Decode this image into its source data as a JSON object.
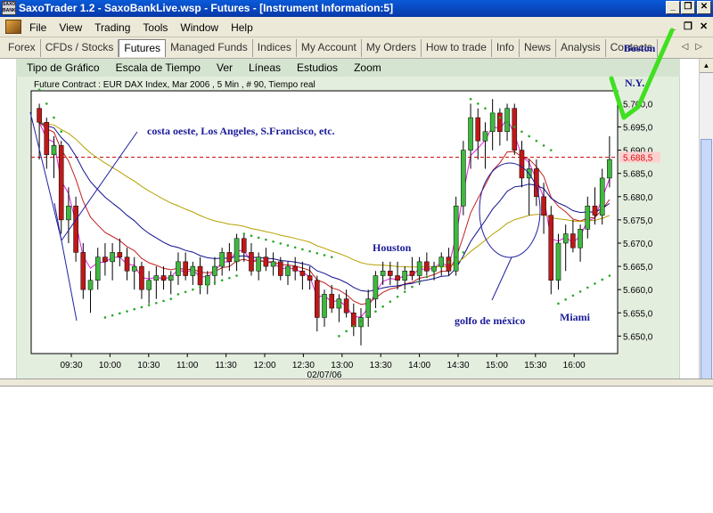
{
  "window": {
    "title": "SaxoTrader 1.2 - SaxoBankLive.wsp - Futures - [Instrument Information:5]",
    "app_icon_text": "SAXO BANK",
    "controls": {
      "minimize": "_",
      "restore": "❐",
      "close": "✕"
    }
  },
  "menubar": {
    "items": [
      "File",
      "View",
      "Trading",
      "Tools",
      "Window",
      "Help"
    ],
    "mdi_controls": {
      "minimize": "_",
      "restore": "❐",
      "close": "✕"
    }
  },
  "tabs": {
    "items": [
      "Forex",
      "CFDs / Stocks",
      "Futures",
      "Managed Funds",
      "Indices",
      "My Account",
      "My Orders",
      "How to trade",
      "Info",
      "News",
      "Analysis",
      "Contacts"
    ],
    "active": "Futures",
    "arrows": {
      "left": "◁",
      "right": "▷"
    }
  },
  "chart_menu": {
    "items": [
      "Tipo de Gráfico",
      "Escala de Tiempo",
      "Ver",
      "Líneas",
      "Estudios",
      "Zoom"
    ]
  },
  "chart_data": {
    "type": "candlestick",
    "title": "Future Contract : EUR DAX Index, Mar 2006 , 5 Min , # 90, Tiempo real",
    "x_ticks": [
      "09:30",
      "10:00",
      "10:30",
      "11:00",
      "11:30",
      "12:00",
      "12:30",
      "13:00",
      "13:30",
      "14:00",
      "14:30",
      "15:00",
      "15:30",
      "16:00"
    ],
    "date_label": "02/07/06",
    "y_ticks": [
      "5.700,0",
      "5.695,0",
      "5.690,0",
      "5.685,0",
      "5.680,0",
      "5.675,0",
      "5.670,0",
      "5.665,0",
      "5.660,0",
      "5.655,0",
      "5.650,0"
    ],
    "ylim": [
      5647,
      5702
    ],
    "reference_line": {
      "value": 5688.5,
      "label": "5.688,5",
      "color": "#d01010"
    },
    "colors": {
      "up": "#40b840",
      "down": "#c01818",
      "sar": "#28a828",
      "ma_fast": "#e020e0",
      "ma_mid": "#c02020",
      "ma_slow": "#101090",
      "ma_long": "#b8a000"
    },
    "candles": [
      [
        5699,
        5700,
        5688,
        5696
      ],
      [
        5696,
        5697,
        5686,
        5689
      ],
      [
        5689,
        5693,
        5684,
        5691
      ],
      [
        5691,
        5692,
        5672,
        5675
      ],
      [
        5675,
        5682,
        5670,
        5678
      ],
      [
        5678,
        5680,
        5666,
        5668
      ],
      [
        5668,
        5670,
        5658,
        5660
      ],
      [
        5660,
        5664,
        5655,
        5662
      ],
      [
        5662,
        5669,
        5660,
        5667
      ],
      [
        5667,
        5670,
        5663,
        5666
      ],
      [
        5666,
        5670,
        5662,
        5668
      ],
      [
        5668,
        5671,
        5665,
        5667
      ],
      [
        5667,
        5669,
        5662,
        5664
      ],
      [
        5664,
        5667,
        5660,
        5665
      ],
      [
        5665,
        5666,
        5658,
        5660
      ],
      [
        5660,
        5664,
        5657,
        5662
      ],
      [
        5662,
        5665,
        5658,
        5663
      ],
      [
        5663,
        5665,
        5660,
        5662
      ],
      [
        5662,
        5664,
        5659,
        5663
      ],
      [
        5663,
        5668,
        5661,
        5666
      ],
      [
        5666,
        5668,
        5662,
        5663
      ],
      [
        5663,
        5666,
        5661,
        5665
      ],
      [
        5665,
        5667,
        5659,
        5661
      ],
      [
        5661,
        5664,
        5659,
        5663
      ],
      [
        5663,
        5667,
        5661,
        5665
      ],
      [
        5665,
        5669,
        5663,
        5668
      ],
      [
        5668,
        5670,
        5664,
        5666
      ],
      [
        5666,
        5672,
        5664,
        5671
      ],
      [
        5671,
        5672,
        5666,
        5668
      ],
      [
        5668,
        5670,
        5663,
        5664
      ],
      [
        5664,
        5668,
        5662,
        5667
      ],
      [
        5667,
        5669,
        5664,
        5665
      ],
      [
        5665,
        5668,
        5663,
        5666
      ],
      [
        5666,
        5667,
        5662,
        5663
      ],
      [
        5663,
        5666,
        5661,
        5665
      ],
      [
        5665,
        5667,
        5662,
        5664
      ],
      [
        5664,
        5666,
        5660,
        5663
      ],
      [
        5663,
        5665,
        5660,
        5662
      ],
      [
        5662,
        5663,
        5651,
        5654
      ],
      [
        5654,
        5660,
        5652,
        5659
      ],
      [
        5659,
        5661,
        5655,
        5656
      ],
      [
        5656,
        5659,
        5653,
        5658
      ],
      [
        5658,
        5660,
        5654,
        5655
      ],
      [
        5655,
        5657,
        5650,
        5652
      ],
      [
        5652,
        5656,
        5648,
        5654
      ],
      [
        5654,
        5660,
        5652,
        5658
      ],
      [
        5658,
        5664,
        5656,
        5663
      ],
      [
        5663,
        5666,
        5661,
        5664
      ],
      [
        5664,
        5666,
        5661,
        5663
      ],
      [
        5663,
        5666,
        5660,
        5662
      ],
      [
        5662,
        5665,
        5660,
        5664
      ],
      [
        5664,
        5667,
        5662,
        5663
      ],
      [
        5663,
        5667,
        5661,
        5666
      ],
      [
        5666,
        5668,
        5663,
        5664
      ],
      [
        5664,
        5666,
        5662,
        5665
      ],
      [
        5665,
        5668,
        5663,
        5667
      ],
      [
        5667,
        5669,
        5663,
        5664
      ],
      [
        5664,
        5680,
        5663,
        5678
      ],
      [
        5678,
        5692,
        5676,
        5690
      ],
      [
        5690,
        5700,
        5686,
        5697
      ],
      [
        5697,
        5699,
        5688,
        5692
      ],
      [
        5692,
        5696,
        5686,
        5694
      ],
      [
        5694,
        5701,
        5690,
        5698
      ],
      [
        5698,
        5699,
        5691,
        5694
      ],
      [
        5694,
        5700,
        5692,
        5699
      ],
      [
        5699,
        5700,
        5689,
        5690
      ],
      [
        5690,
        5692,
        5682,
        5684
      ],
      [
        5684,
        5688,
        5676,
        5686
      ],
      [
        5686,
        5688,
        5678,
        5680
      ],
      [
        5680,
        5683,
        5672,
        5676
      ],
      [
        5676,
        5678,
        5659,
        5662
      ],
      [
        5662,
        5672,
        5660,
        5670
      ],
      [
        5670,
        5674,
        5664,
        5672
      ],
      [
        5672,
        5675,
        5668,
        5669
      ],
      [
        5669,
        5674,
        5666,
        5673
      ],
      [
        5673,
        5680,
        5671,
        5678
      ],
      [
        5678,
        5682,
        5674,
        5676
      ],
      [
        5676,
        5686,
        5674,
        5684
      ],
      [
        5684,
        5693,
        5682,
        5688
      ]
    ],
    "sar_groups": [
      {
        "start": 0,
        "end": 3,
        "from": 5703,
        "to": 5694
      },
      {
        "start": 9,
        "end": 18,
        "from": 5654,
        "to": 5658
      },
      {
        "start": 19,
        "end": 27,
        "from": 5659,
        "to": 5663
      },
      {
        "start": 28,
        "end": 40,
        "from": 5672,
        "to": 5667
      },
      {
        "start": 41,
        "end": 58,
        "from": 5650,
        "to": 5668
      },
      {
        "start": 59,
        "end": 70,
        "from": 5701,
        "to": 5690
      },
      {
        "start": 71,
        "end": 78,
        "from": 5657,
        "to": 5663
      }
    ],
    "annotations": [
      {
        "text": "costa oeste, Los Angeles, S.Francisco, etc."
      },
      {
        "text": "Houston"
      },
      {
        "text": "golfo de méxico"
      },
      {
        "text": "Miami"
      },
      {
        "text": "Boston"
      },
      {
        "text": "N.Y."
      }
    ]
  }
}
